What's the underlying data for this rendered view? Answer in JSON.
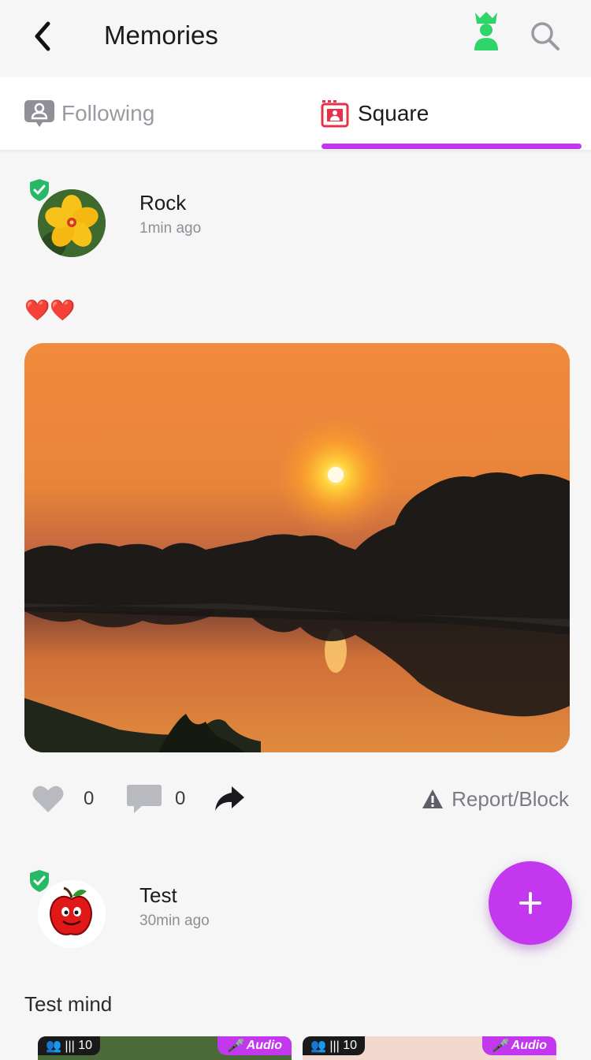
{
  "header": {
    "title": "Memories"
  },
  "tabs": [
    {
      "label": "Following",
      "active": false
    },
    {
      "label": "Square",
      "active": true
    }
  ],
  "posts": [
    {
      "username": "Rock",
      "time": "1min ago",
      "text": "❤️❤️",
      "likes": "0",
      "comments": "0",
      "report_label": "Report/Block",
      "verified": true
    },
    {
      "username": "Test",
      "time": "30min ago",
      "text": "Test mind",
      "verified": true,
      "thumbnails": [
        {
          "count": "10",
          "badge": "Audio"
        },
        {
          "count": "10",
          "badge": "Audio"
        }
      ]
    }
  ],
  "fab": {
    "label": "+"
  },
  "colors": {
    "accent": "#c338ee",
    "verified": "#27b868",
    "vip": "#2fd46a"
  }
}
